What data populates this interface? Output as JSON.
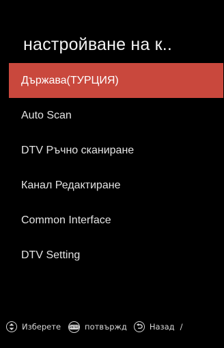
{
  "header": {
    "title": "настройване на к.."
  },
  "menu": {
    "items": [
      {
        "label": "Държава(ТУРЦИЯ)",
        "selected": true
      },
      {
        "label": "Auto Scan"
      },
      {
        "label": "DTV Ръчно сканиране"
      },
      {
        "label": "Канал Редактиране"
      },
      {
        "label": "Common Interface"
      },
      {
        "label": "DTV Setting"
      }
    ]
  },
  "footer": {
    "select_label": "Изберете",
    "enter_icon_text": "ENTER",
    "confirm_label": "потвържд",
    "back_label": "Назад",
    "trailing": "/"
  },
  "colors": {
    "highlight": "#c9483d",
    "background": "#000000",
    "text": "#e9e9e9"
  },
  "icons": [
    "up-down-nav-icon",
    "enter-icon",
    "back-icon"
  ]
}
